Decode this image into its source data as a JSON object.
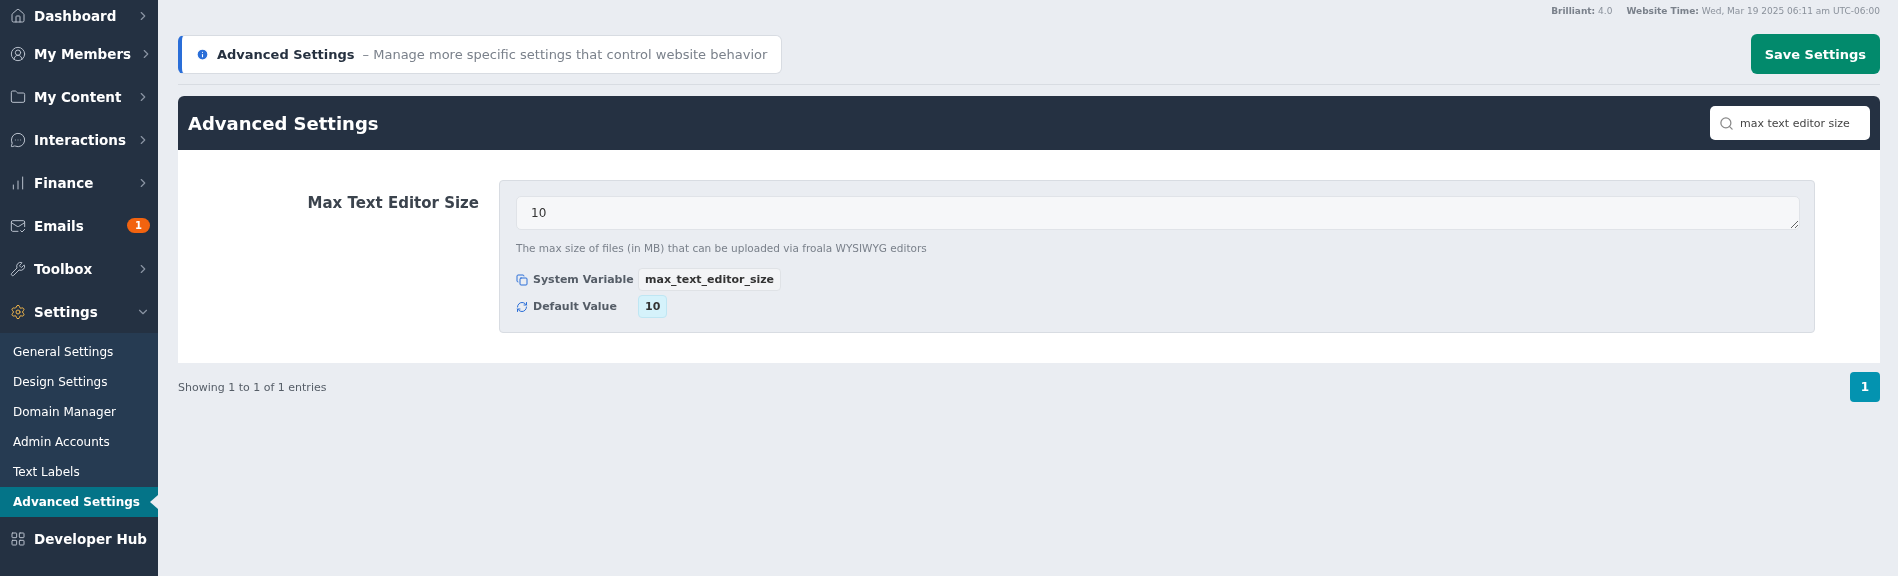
{
  "sidebar": {
    "items": [
      {
        "kind": "menu",
        "label": "Dashboard"
      },
      {
        "kind": "menu",
        "label": "My Members"
      },
      {
        "kind": "menu",
        "label": "My Content"
      },
      {
        "kind": "menu",
        "label": "Interactions"
      },
      {
        "kind": "menu",
        "label": "Finance"
      },
      {
        "kind": "badge",
        "label": "Emails",
        "badge": "1"
      },
      {
        "kind": "menu",
        "label": "Toolbox"
      },
      {
        "kind": "group",
        "label": "Settings",
        "expanded": true,
        "children": [
          {
            "label": "General Settings",
            "selected": false
          },
          {
            "label": "Design Settings",
            "selected": false
          },
          {
            "label": "Domain Manager",
            "selected": false
          },
          {
            "label": "Admin Accounts",
            "selected": false
          },
          {
            "label": "Text Labels",
            "selected": false
          },
          {
            "label": "Advanced Settings",
            "selected": true
          }
        ]
      },
      {
        "kind": "plain",
        "label": "Developer Hub"
      }
    ]
  },
  "top_bar": {
    "version_label": "Brilliant:",
    "version": "4.0",
    "time_label": "Website Time:",
    "time": "Wed, Mar 19 2025 06:11 am UTC-06:00"
  },
  "banner": {
    "title": "Advanced Settings",
    "description": "– Manage more specific settings that control website behavior"
  },
  "save_button": "Save Settings",
  "panel": {
    "title": "Advanced Settings",
    "search": {
      "value": "max text editor size"
    }
  },
  "settings": [
    {
      "label": "Max Text Editor Size",
      "value": "10",
      "help": "The max size of files (in MB) that can be uploaded via froala WYSIWYG editors",
      "variable_label": "System Variable",
      "variable": "max_text_editor_size",
      "default_label": "Default Value",
      "default": "10"
    }
  ],
  "footer": {
    "entries": "Showing 1 to 1 of 1 entries",
    "pages": [
      {
        "label": "1",
        "selected": true
      }
    ]
  }
}
